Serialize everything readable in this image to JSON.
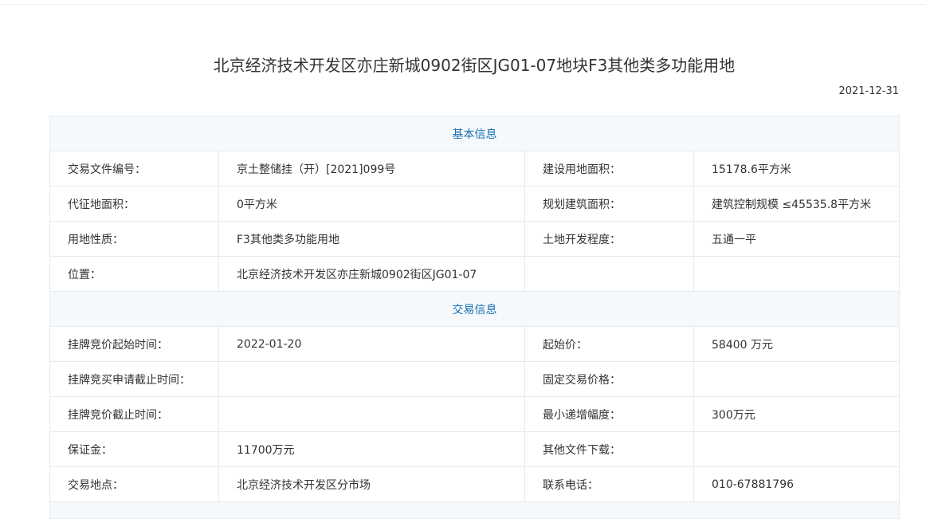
{
  "page": {
    "title": "北京经济技术开发区亦庄新城0902街区JG01-07地块F3其他类多功能用地",
    "date": "2021-12-31"
  },
  "sections": [
    {
      "title": "基本信息",
      "rows": [
        {
          "l1": "交易文件编号：",
          "v1": "京土整储挂（开）[2021]099号",
          "l2": "建设用地面积：",
          "v2": "15178.6平方米"
        },
        {
          "l1": "代征地面积：",
          "v1": "0平方米",
          "l2": "规划建筑面积：",
          "v2": "建筑控制规模 ≤45535.8平方米"
        },
        {
          "l1": "用地性质：",
          "v1": "F3其他类多功能用地",
          "l2": "土地开发程度：",
          "v2": "五通一平"
        },
        {
          "l1": "位置：",
          "v1": "北京经济技术开发区亦庄新城0902街区JG01-07",
          "l2": "",
          "v2": ""
        }
      ]
    },
    {
      "title": "交易信息",
      "rows": [
        {
          "l1": "挂牌竞价起始时间：",
          "v1": "2022-01-20",
          "l2": "起始价：",
          "v2": "58400 万元"
        },
        {
          "l1": "挂牌竞买申请截止时间：",
          "v1": "",
          "l2": "固定交易价格：",
          "v2": ""
        },
        {
          "l1": "挂牌竞价截止时间：",
          "v1": "",
          "l2": "最小递增幅度：",
          "v2": "300万元"
        },
        {
          "l1": "保证金：",
          "v1": "11700万元",
          "l2": "其他文件下载：",
          "v2": ""
        },
        {
          "l1": "交易地点：",
          "v1": "北京经济技术开发区分市场",
          "l2": "联系电话：",
          "v2": "010-67881796"
        }
      ]
    }
  ]
}
